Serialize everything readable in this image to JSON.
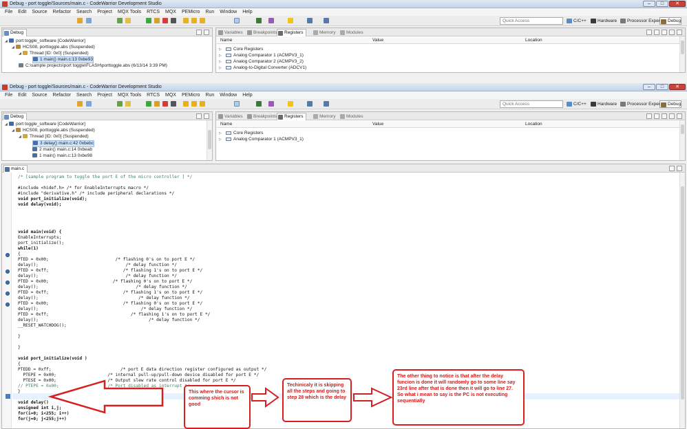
{
  "window_top": {
    "title": "Debug - port toggle/Sources/main.c - CodeWarrior Development Studio",
    "menu": [
      "File",
      "Edit",
      "Source",
      "Refactor",
      "Search",
      "Project",
      "MQX Tools",
      "RTCS",
      "MQX",
      "PEMicro",
      "Run",
      "Window",
      "Help"
    ],
    "quick_access": "Quick Access",
    "perspectives": [
      "C/C++",
      "Hardware",
      "Processor Expert",
      "Debug"
    ],
    "debug_tab": "Debug",
    "debug_tree": [
      "port toggle_software [CodeWarrior]",
      "HCS08, porttoggle.abs (Suspended)",
      "Thread [ID: 0x0] (Suspended)",
      "1 main() main.c:13 0xbe93",
      "C:\\sample projects\\port toggle\\FLASH\\porttoggle.abs (6/13/14 3:39 PM)"
    ],
    "right_tabs": [
      "Variables",
      "Breakpoints",
      "Registers",
      "Memory",
      "Modules"
    ],
    "reg_columns": [
      "Name",
      "Value",
      "Location"
    ],
    "reg_rows": [
      "Core Registers",
      "Analog Comparator 1 (ACMPV3_1)",
      "Analog Comparator 2 (ACMPV3_2)",
      "Analog-to-Digital Converter (ADCV1)"
    ]
  },
  "window_main": {
    "title": "Debug - port toggle/Sources/main.c - CodeWarrior Development Studio",
    "menu": [
      "File",
      "Edit",
      "Source",
      "Refactor",
      "Search",
      "Project",
      "MQX Tools",
      "RTCS",
      "MQX",
      "PEMicro",
      "Run",
      "Window",
      "Help"
    ],
    "quick_access": "Quick Access",
    "perspectives": [
      "C/C++",
      "Hardware",
      "Processor Expert",
      "Debug"
    ],
    "debug_tab": "Debug",
    "debug_tree": [
      "port toggle_software [CodeWarrior]",
      "HCS08, porttoggle.abs (Suspended)",
      "Thread [ID: 0x0] (Suspended)",
      "3 delay() main.c:42 0xbebc",
      "2 main() main.c:14 0xbeab",
      "1 main() main.c:13 0xbe98"
    ],
    "right_tabs": [
      "Variables",
      "Breakpoints",
      "Registers",
      "Memory",
      "Modules"
    ],
    "reg_columns": [
      "Name",
      "Value",
      "Location"
    ],
    "reg_rows": [
      "Core Registers",
      "Analog Comparator 1 (ACMPV3_1)"
    ]
  },
  "editor": {
    "tab": "main.c",
    "code": [
      "/* [sample program to toggle the port E of the micro controller ] */",
      "",
      "#include <hidef.h> /* for EnableInterrupts macro */",
      "#include \"derivative.h\" /* include peripheral declarations */",
      "void port_initialize(void);",
      "void delay(void);",
      "",
      "",
      "",
      "",
      "void main(void) {",
      "EnableInterrupts;",
      "port_initialize();",
      "while(1)",
      "{",
      "PTED = 0x00;                          /* flashing 0's on to port E */",
      "delay();                                  /* delay function */",
      "PTED = 0xff;                             /* flashing 1's on to port E */",
      "delay();                                  /* delay function */",
      "PTED = 0x00;                         /* flashing 0's on to port E */",
      "delay();                                      /* delay function */",
      "PTED = 0xff;                             /* flashing 1's on to port E */",
      "delay();                                       /* delay function */",
      "PTED = 0x00;                             /* flashing 0's on to port E */",
      "delay();                                        /* delay function */",
      "PTED = 0xff;                                /* flashing 1's on to port E */",
      "delay();                                           /* delay function */",
      "__RESET_WATCHDOG();",
      "",
      "}",
      "",
      "}",
      "",
      "void port_initialize(void )",
      "{",
      "PTEDD = 0xff;                           /* port E data direction register configured as output */",
      "  PTEPE = 0x00;                    /* internal pull-up/pull-down device disabled for port E */",
      "  PTESE = 0x00;                    /* Output slew rate control disabled for port E */",
      "// PTEPE = 0x00;                   /* Port disabled as interrupt */",
      "}",
      "",
      "void delay()",
      "unsigned int i,j;",
      "for(i=0; i<255; i++)",
      "for(j=0; j<255;j++)"
    ]
  },
  "annotations": [
    "This where the cursor is comming shich is not good",
    "Techinicaly it is skipping all the steps and going to step 28 which is the delay",
    "The other thing to notice is that after the delay funcion is done it will randomly go to some line say 23rd line after that is done then it will go to line 27. So what i mean to say is the PC is not executing sequentially"
  ],
  "colors": {
    "annotation": "#d62020",
    "selection": "#cfe3fb",
    "current_line": "#e8f2fe"
  }
}
